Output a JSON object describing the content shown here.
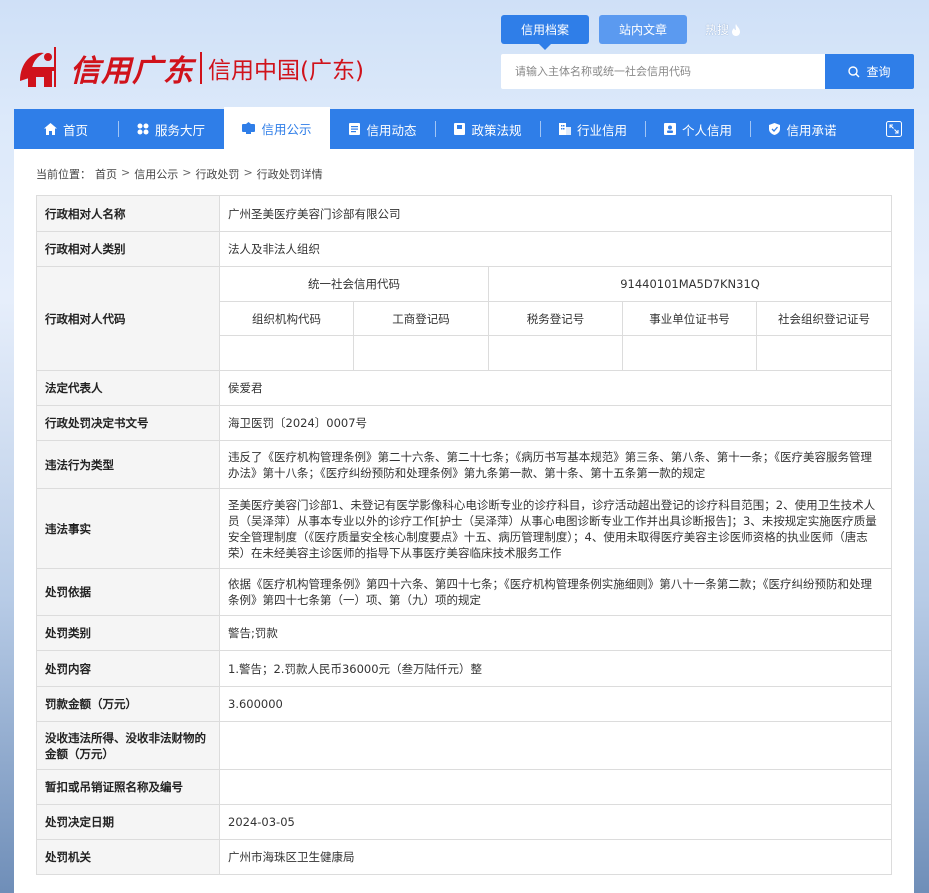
{
  "header": {
    "logo_script": "信用广东",
    "logo_text": "信用中国(广东)",
    "top_tabs": [
      "信用档案",
      "站内文章"
    ],
    "hot_label": "热搜",
    "search_placeholder": "请输入主体名称或统一社会信用代码",
    "search_button": "查询"
  },
  "nav": {
    "items": [
      {
        "label": "首页",
        "icon": "home-icon"
      },
      {
        "label": "服务大厅",
        "icon": "grid-icon"
      },
      {
        "label": "信用公示",
        "icon": "monitor-icon"
      },
      {
        "label": "信用动态",
        "icon": "document-icon"
      },
      {
        "label": "政策法规",
        "icon": "book-icon"
      },
      {
        "label": "行业信用",
        "icon": "building-icon"
      },
      {
        "label": "个人信用",
        "icon": "id-card-icon"
      },
      {
        "label": "信用承诺",
        "icon": "shield-icon"
      }
    ],
    "active_index": 2
  },
  "breadcrumb": {
    "prefix": "当前位置：",
    "items": [
      "首页",
      "信用公示",
      "行政处罚",
      "行政处罚详情"
    ]
  },
  "detail": {
    "subject_name_label": "行政相对人名称",
    "subject_name": "广州圣美医疗美容门诊部有限公司",
    "subject_type_label": "行政相对人类别",
    "subject_type": "法人及非法人组织",
    "subject_code_label": "行政相对人代码",
    "uscc_label": "统一社会信用代码",
    "uscc_value": "91440101MA5D7KN31Q",
    "code_headers": [
      "组织机构代码",
      "工商登记码",
      "税务登记号",
      "事业单位证书号",
      "社会组织登记证号"
    ],
    "code_values": [
      "",
      "",
      "",
      "",
      ""
    ],
    "legal_rep_label": "法定代表人",
    "legal_rep": "侯爱君",
    "decision_no_label": "行政处罚决定书文号",
    "decision_no": "海卫医罚〔2024〕0007号",
    "violation_type_label": "违法行为类型",
    "violation_type": "违反了《医疗机构管理条例》第二十六条、第二十七条；《病历书写基本规范》第三条、第八条、第十一条；《医疗美容服务管理办法》第十八条；《医疗纠纷预防和处理条例》第九条第一款、第十条、第十五条第一款的规定",
    "facts_label": "违法事实",
    "facts": "圣美医疗美容门诊部1、未登记有医学影像科心电诊断专业的诊疗科目，诊疗活动超出登记的诊疗科目范围；2、使用卫生技术人员（吴泽萍）从事本专业以外的诊疗工作[护士（吴泽萍）从事心电图诊断专业工作并出具诊断报告]；3、未按规定实施医疗质量安全管理制度（《医疗质量安全核心制度要点》十五、病历管理制度）；4、使用未取得医疗美容主诊医师资格的执业医师（唐志荣）在未经美容主诊医师的指导下从事医疗美容临床技术服务工作",
    "basis_label": "处罚依据",
    "basis": "依据《医疗机构管理条例》第四十六条、第四十七条；《医疗机构管理条例实施细则》第八十一条第二款；《医疗纠纷预防和处理条例》第四十七条第（一）项、第（九）项的规定",
    "penalty_type_label": "处罚类别",
    "penalty_type": "警告;罚款",
    "penalty_content_label": "处罚内容",
    "penalty_content": "1.警告；2.罚款人民币36000元（叁万陆仟元）整",
    "fine_label": "罚款金额（万元）",
    "fine": "3.600000",
    "confiscation_label": "没收违法所得、没收非法财物的金额（万元）",
    "confiscation": "",
    "license_label": "暂扣或吊销证照名称及编号",
    "license": "",
    "decision_date_label": "处罚决定日期",
    "decision_date": "2024-03-05",
    "authority_label": "处罚机关",
    "authority": "广州市海珠区卫生健康局"
  }
}
